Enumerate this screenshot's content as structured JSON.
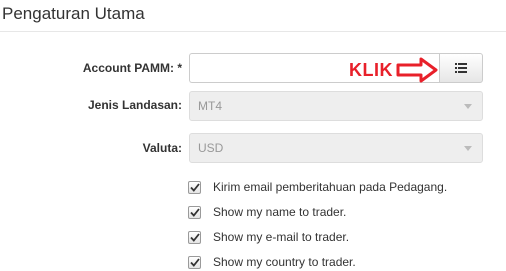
{
  "page": {
    "title": "Pengaturan Utama"
  },
  "form": {
    "account": {
      "label": "Account PAMM: *",
      "value": "",
      "placeholder": ""
    },
    "platform": {
      "label": "Jenis Landasan:",
      "selected": "MT4"
    },
    "currency": {
      "label": "Valuta:",
      "selected": "USD"
    }
  },
  "annotation": {
    "text": "KLIK",
    "color": "#e8202a"
  },
  "checkboxes": [
    {
      "label": "Kirim email pemberitahuan pada Pedagang.",
      "checked": true
    },
    {
      "label": "Show my name to trader.",
      "checked": true
    },
    {
      "label": "Show my e-mail to trader.",
      "checked": true
    },
    {
      "label": "Show my country to trader.",
      "checked": true
    }
  ],
  "icons": {
    "list_button": "list-icon",
    "annotation_arrow": "arrow-right-icon",
    "select_caret": "caret-down-icon",
    "checkbox_mark": "check-icon"
  }
}
